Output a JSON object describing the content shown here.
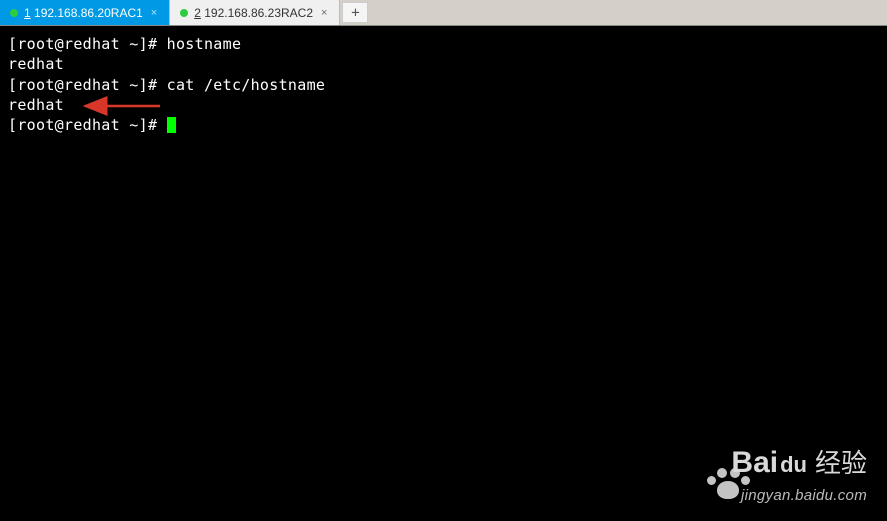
{
  "tabs": [
    {
      "num": "1",
      "label": "192.168.86.20RAC1",
      "active": true
    },
    {
      "num": "2",
      "label": "192.168.86.23RAC2",
      "active": false
    }
  ],
  "newTabGlyph": "+",
  "closeGlyph": "×",
  "terminal": {
    "lines": [
      {
        "prompt": "[root@redhat ~]# ",
        "cmd": "hostname"
      },
      {
        "output": "redhat"
      },
      {
        "prompt": "[root@redhat ~]# ",
        "cmd": "cat /etc/hostname"
      },
      {
        "output": "redhat"
      },
      {
        "prompt": "[root@redhat ~]# ",
        "cursor": true
      }
    ]
  },
  "watermark": {
    "brand": "Bai",
    "du": "du",
    "cn": "经验",
    "url": "jingyan.baidu.com"
  }
}
